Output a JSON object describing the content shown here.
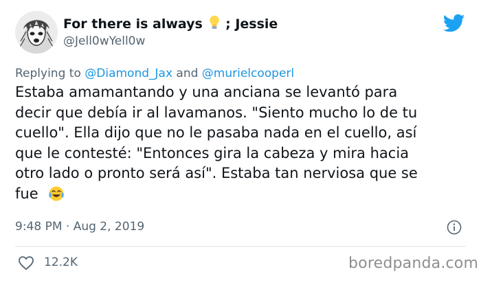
{
  "author": {
    "name_before": "For there is always",
    "name_after": "; Jessie",
    "bulb_icon": "lightbulb-emoji",
    "handle": "@Jell0wYell0w"
  },
  "platform_icon": "twitter-bird-icon",
  "reply": {
    "prefix": "Replying to",
    "mention1": "@Diamond_Jax",
    "conjunction": "and",
    "mention2": "@murielcooperl"
  },
  "tweet": {
    "lines": [
      "Estaba amamantando y una anciana se levantó para",
      "decir que debía ir al lavamanos. \"Siento mucho lo de tu",
      "cuello\". Ella dijo que no le pasaba nada en el cuello, así",
      "que le contesté: \"Entonces gira la cabeza y mira hacia",
      "otro lado o pronto será así\". Estaba tan nerviosa que se",
      "fue"
    ],
    "emoji": "face-with-tears-of-joy-emoji"
  },
  "meta": {
    "timestamp": "9:48 PM · Aug 2, 2019",
    "likes": "12.2K"
  },
  "watermark": "boredpanda.com",
  "colors": {
    "twitter_blue": "#1da1f2",
    "mention_blue": "#1b95e0",
    "secondary_text": "#536471"
  }
}
